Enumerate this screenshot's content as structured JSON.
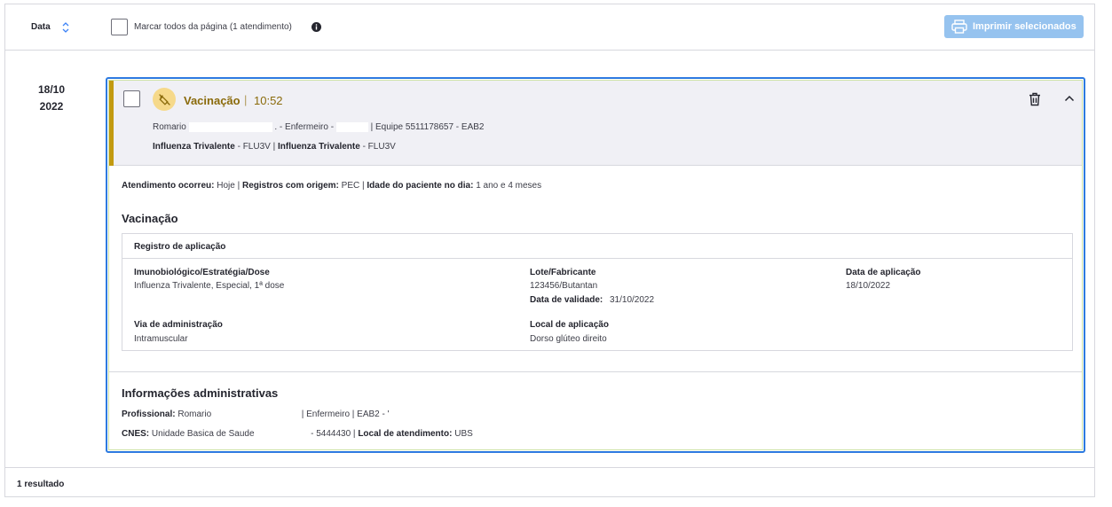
{
  "toolbar": {
    "sort_label": "Data",
    "select_all_label": "Marcar todos da página (1 atendimento)",
    "print_label": "Imprimir selecionados"
  },
  "entry": {
    "date_day": "18/10",
    "date_year": "2022",
    "type_label": "Vacinação",
    "separator": "|",
    "time": "10:52",
    "line1_prof": "Romario",
    "line1_role": ". - Enfermeiro -",
    "line1_team": "| Equipe 5511178657 - EAB2",
    "line2_vacc1_label": "Influenza Trivalente",
    "line2_vacc1_code": "- FLU3V |",
    "line2_vacc2_label": "Influenza Trivalente",
    "line2_vacc2_code": "- FLU3V"
  },
  "attendance": {
    "occurred_label": "Atendimento ocorreu:",
    "occurred_value": "Hoje |",
    "origin_label": "Registros com origem:",
    "origin_value": "PEC |",
    "age_label": "Idade do paciente no dia:",
    "age_value": "1 ano e 4 meses"
  },
  "vaccination": {
    "section_title": "Vacinação",
    "box_title": "Registro de aplicação",
    "immuno_label": "Imunobiológico/Estratégia/Dose",
    "immuno_value": "Influenza Trivalente, Especial, 1ª dose",
    "lot_label": "Lote/Fabricante",
    "lot_value": "123456/Butantan",
    "validity_label": "Data de validade:",
    "validity_value": "31/10/2022",
    "application_date_label": "Data de aplicação",
    "application_date_value": "18/10/2022",
    "route_label": "Via de administração",
    "route_value": "Intramuscular",
    "site_label": "Local de aplicação",
    "site_value": "Dorso glúteo direito"
  },
  "admin": {
    "section_title": "Informações administrativas",
    "professional_label": "Profissional:",
    "professional_value": "Romario",
    "professional_rest": "| Enfermeiro | EAB2 - '",
    "cnes_label": "CNES:",
    "cnes_value": "Unidade Basica de Saude",
    "cnes_code": "- 5444430 |",
    "location_label": "Local de atendimento:",
    "location_value": "UBS"
  },
  "footer": {
    "results": "1 resultado"
  },
  "colors": {
    "accent_bar": "#c29a10",
    "card_border": "#2d7ae0",
    "print_button": "#96c3ef",
    "vaccine_badge": "#f6d98a"
  }
}
